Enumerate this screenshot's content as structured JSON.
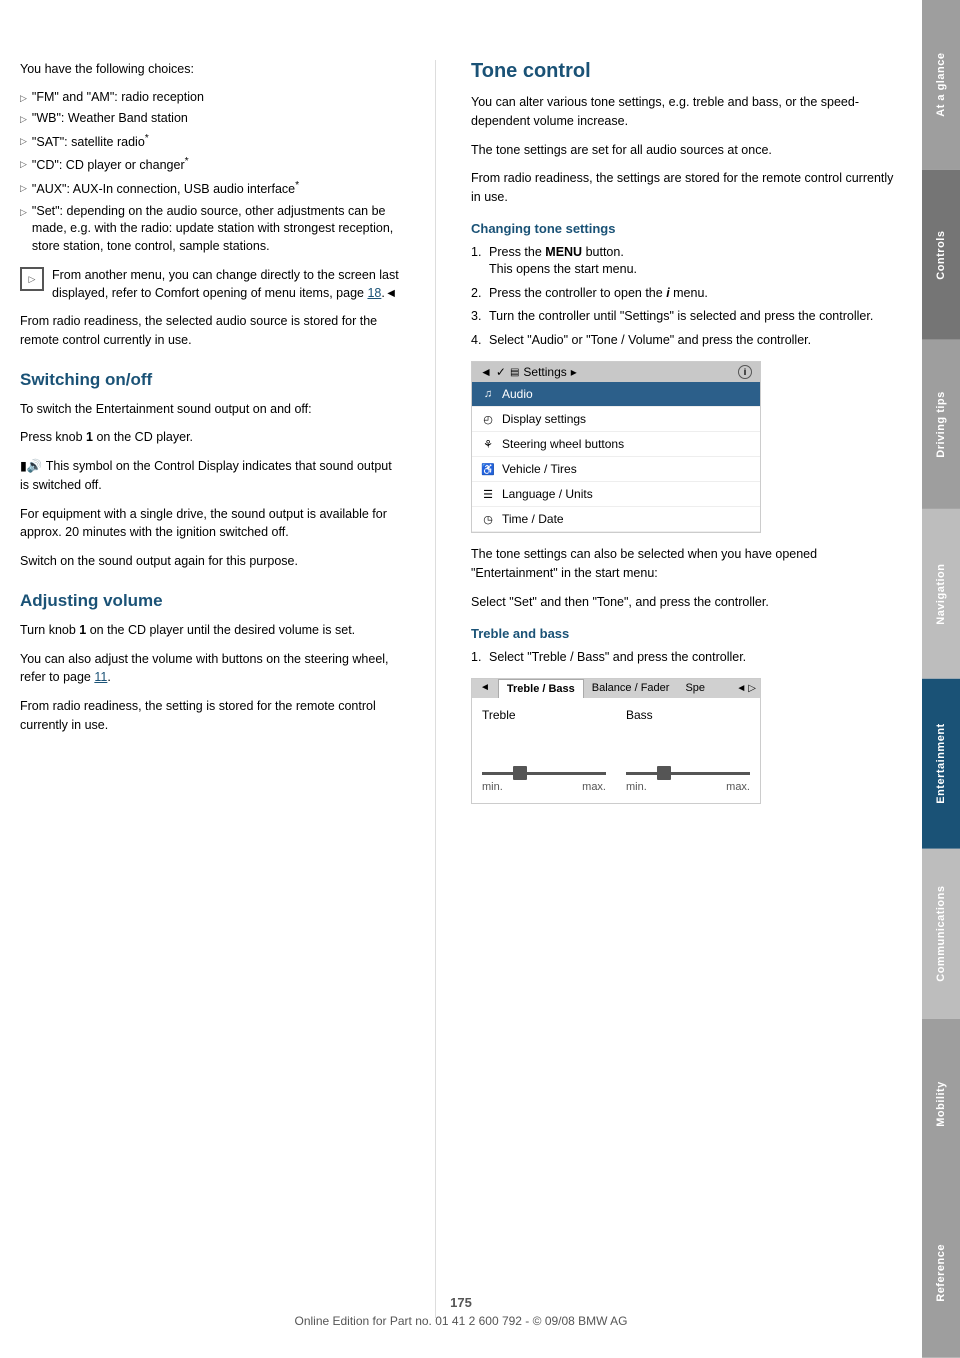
{
  "page": {
    "number": "175",
    "footer_text": "Online Edition for Part no. 01 41 2 600 792 - © 09/08 BMW AG"
  },
  "sidebar": {
    "tabs": [
      {
        "label": "At a glance",
        "color": "gray"
      },
      {
        "label": "Controls",
        "color": "gray-dark"
      },
      {
        "label": "Driving tips",
        "color": "gray"
      },
      {
        "label": "Navigation",
        "color": "gray-mid"
      },
      {
        "label": "Entertainment",
        "color": "blue-active"
      },
      {
        "label": "Communications",
        "color": "gray-mid"
      },
      {
        "label": "Mobility",
        "color": "gray"
      },
      {
        "label": "Reference",
        "color": "gray"
      }
    ]
  },
  "left_column": {
    "intro": "You have the following choices:",
    "bullets": [
      {
        "text": "\"FM\" and \"AM\": radio reception"
      },
      {
        "text": "\"WB\": Weather Band station"
      },
      {
        "text": "\"SAT\": satellite radio*"
      },
      {
        "text": "\"CD\": CD player or changer*"
      },
      {
        "text": "\"AUX\": AUX-In connection, USB audio interface*"
      },
      {
        "text": "\"Set\": depending on the audio source, other adjustments can be made, e.g. with the radio: update station with strongest reception, store station, tone control, sample stations."
      }
    ],
    "note": "From another menu, you can change directly to the screen last displayed, refer to Comfort opening of menu items, page 18.",
    "paragraph1": "From radio readiness, the selected audio source is stored for the remote control currently in use.",
    "section1_title": "Switching on/off",
    "section1_paragraphs": [
      "To switch the Entertainment sound output on and off:",
      "Press knob 1 on the CD player.",
      "This symbol on the Control Display indicates that sound output is switched off.",
      "For equipment with a single drive, the sound output is available for approx. 20 minutes with the ignition switched off.",
      "Switch on the sound output again for this purpose."
    ],
    "section2_title": "Adjusting volume",
    "section2_paragraphs": [
      "Turn knob 1 on the CD player until the desired volume is set.",
      "You can also adjust the volume with buttons on the steering wheel, refer to page 11.",
      "From radio readiness, the setting is stored for the remote control currently in use."
    ]
  },
  "right_column": {
    "title": "Tone control",
    "intro_paragraphs": [
      "You can alter various tone settings, e.g. treble and bass, or the speed-dependent volume increase.",
      "The tone settings are set for all audio sources at once.",
      "From radio readiness, the settings are stored for the remote control currently in use."
    ],
    "sub1_title": "Changing tone settings",
    "steps": [
      {
        "num": "1.",
        "text": "Press the MENU button.\nThis opens the start menu."
      },
      {
        "num": "2.",
        "text": "Press the controller to open the i menu."
      },
      {
        "num": "3.",
        "text": "Turn the controller until \"Settings\" is selected and press the controller."
      },
      {
        "num": "4.",
        "text": "Select \"Audio\" or \"Tone / Volume\" and press the controller."
      }
    ],
    "settings_menu": {
      "header_left": "◄ ✓ ☰ Settings ▸",
      "header_right": "①",
      "items": [
        {
          "label": "Audio",
          "selected": true,
          "icon": "audio"
        },
        {
          "label": "Display settings",
          "selected": false,
          "icon": "display"
        },
        {
          "label": "Steering wheel buttons",
          "selected": false,
          "icon": "steering"
        },
        {
          "label": "Vehicle / Tires",
          "selected": false,
          "icon": "vehicle"
        },
        {
          "label": "Language / Units",
          "selected": false,
          "icon": "language"
        },
        {
          "label": "Time / Date",
          "selected": false,
          "icon": "time"
        }
      ]
    },
    "after_menu_text": [
      "The tone settings can also be selected when you have opened \"Entertainment\" in the start menu:",
      "Select \"Set\" and then \"Tone\", and press the controller."
    ],
    "sub2_title": "Treble and bass",
    "treble_bass_steps": [
      {
        "num": "1.",
        "text": "Select \"Treble / Bass\" and press the controller."
      }
    ],
    "treble_bass_tabs": [
      "Treble / Bass",
      "Balance / Fader",
      "Spe",
      "◄",
      "▷"
    ],
    "treble_bass_sliders": [
      {
        "label": "Treble",
        "min": "min.",
        "max": "max.",
        "position": 0.3
      },
      {
        "label": "Bass",
        "min": "min.",
        "max": "max.",
        "position": 0.3
      }
    ]
  }
}
